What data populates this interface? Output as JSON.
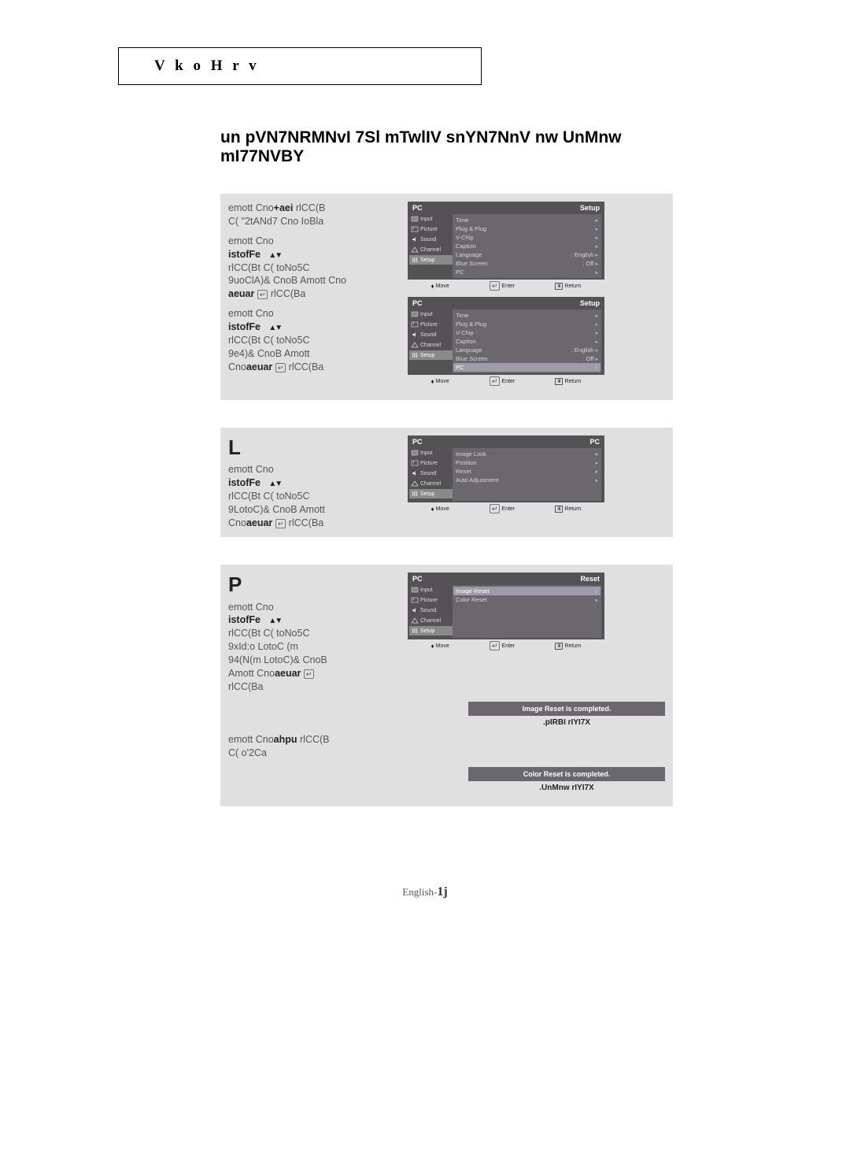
{
  "topbox": "V k o H r v",
  "title": "un pVN7NRMNvI 7Sl mTwlIV snYN7NnV nw UnMnw mI77NVBY",
  "footer_prefix": "English-",
  "footer_page": "1j",
  "step1": {
    "num": "",
    "l1a": "emott Cno",
    "l1b": "+aei",
    "l1c": "  rlCC(B",
    "l2": "C( \"2tANd7 Cno IoBla",
    "l3": "emott Cno",
    "l4a": "istofFe",
    "l4c": "",
    "l5": "rlCC(Bt C( toNo5C",
    "l6": "9uoClA)& CnoB Amott Cno",
    "l7a": "aeuar  ",
    "l7b": " rlCC(Ba",
    "l8": "emott Cno",
    "l9a": "istofFe",
    "l9c": "",
    "l10": "rlCC(Bt C( toNo5C",
    "l11": "9e4)& CnoB Amott",
    "l12a": "Cno",
    "l12b": "aeuar  ",
    "l12c": " rlCC(Ba"
  },
  "step2": {
    "num": "L",
    "l1": "emott Cno",
    "l2a": "istofFe",
    "l3": "rlCC(Bt C( toNo5C",
    "l4": "9LotoC)& CnoB Amott",
    "l5a": "Cno",
    "l5b": "aeuar  ",
    "l5c": " rlCC(Ba"
  },
  "step3": {
    "num": "P",
    "l1": "emott Cno",
    "l2a": "istofFe",
    "l3": "rlCC(Bt C( toNo5C",
    "l4": "9xId:o LotoC (m",
    "l5": "94(N(m LotoC)& CnoB",
    "l6a": "Amott Cno",
    "l6b": "aeuar  ",
    "l7": "rlCC(Ba",
    "after_l1a": "emott Cno",
    "after_l1b": "ahpu ",
    "after_l1c": "rlCC(B",
    "after_l2": "C( o'2Ca"
  },
  "osd_labels": {
    "input": "Input",
    "picture": "Picture",
    "sound": "Sound",
    "channel": "Channel",
    "setup": "Setup",
    "move": "Move",
    "enter": "Enter",
    "return": "Return"
  },
  "osd1": {
    "title_l": "PC",
    "title_r": "Setup",
    "rows": [
      {
        "l": "Time"
      },
      {
        "l": "Plug & Plug"
      },
      {
        "l": "V-Chip"
      },
      {
        "l": "Caption"
      },
      {
        "l": "Language",
        "r": ": English"
      },
      {
        "l": "Blue Screen",
        "r": ": Off"
      },
      {
        "l": "PC"
      }
    ],
    "side_sel": 4
  },
  "osd2": {
    "title_l": "PC",
    "title_r": "Setup",
    "rows": [
      {
        "l": "Time"
      },
      {
        "l": "Plug & Plug"
      },
      {
        "l": "V-Chip"
      },
      {
        "l": "Caption"
      },
      {
        "l": "Language",
        "r": ": English"
      },
      {
        "l": "Blue Screen",
        "r": ": Off"
      },
      {
        "l": "PC"
      }
    ],
    "hi": 6,
    "side_sel": 4
  },
  "osd3": {
    "title_l": "PC",
    "title_r": "PC",
    "rows": [
      {
        "l": "Image Lock"
      },
      {
        "l": "Position"
      },
      {
        "l": "Reset"
      },
      {
        "l": "Auto Adjustment"
      }
    ],
    "side_sel": 4
  },
  "osd4": {
    "title_l": "PC",
    "title_r": "Reset",
    "rows": [
      {
        "l": "Image Reset"
      },
      {
        "l": "Color Reset"
      }
    ],
    "hi": 0,
    "side_sel": 4
  },
  "banner1": "Image Reset is completed.",
  "caption1": ".pIRBI rIYI7X",
  "banner2": "Color Reset is completed.",
  "caption2": ".UnMnw rIYI7X"
}
